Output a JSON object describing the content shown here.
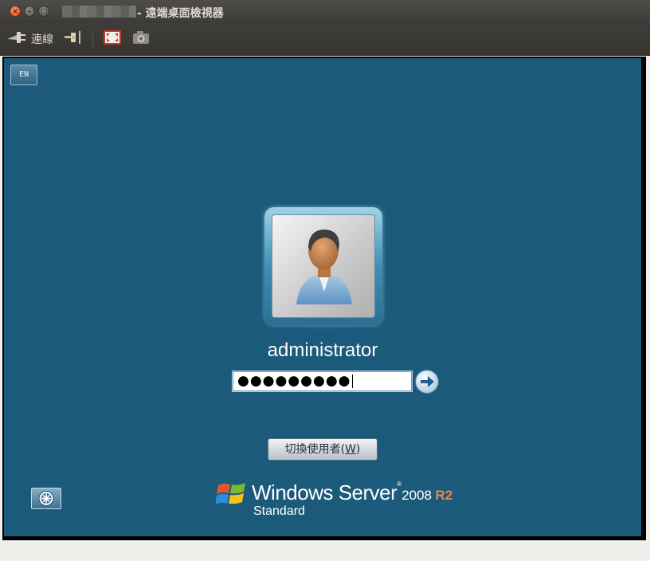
{
  "window": {
    "title": "- 遠端桌面檢視器",
    "controls": {
      "close": "×",
      "minimize": "–",
      "maximize": "□"
    }
  },
  "toolbar": {
    "connect_label": "連線",
    "icons": [
      "connect-plug-icon",
      "disconnect-plug-icon",
      "fullscreen-icon",
      "screenshot-camera-icon"
    ]
  },
  "remote": {
    "language_indicator": "EN",
    "username": "administrator",
    "password_mask": "●●●●●●●●●",
    "switch_user_label": "切換使用者(",
    "switch_user_accel": "W",
    "switch_user_end": ")",
    "brand": {
      "name": "Windows Server",
      "tm": "®",
      "year": "2008",
      "release": "R2",
      "edition": "Standard"
    }
  },
  "colors": {
    "desktop_background": "#1c5a7b",
    "titlebar": "#3c3b37",
    "r2_accent": "#e08a4a"
  }
}
